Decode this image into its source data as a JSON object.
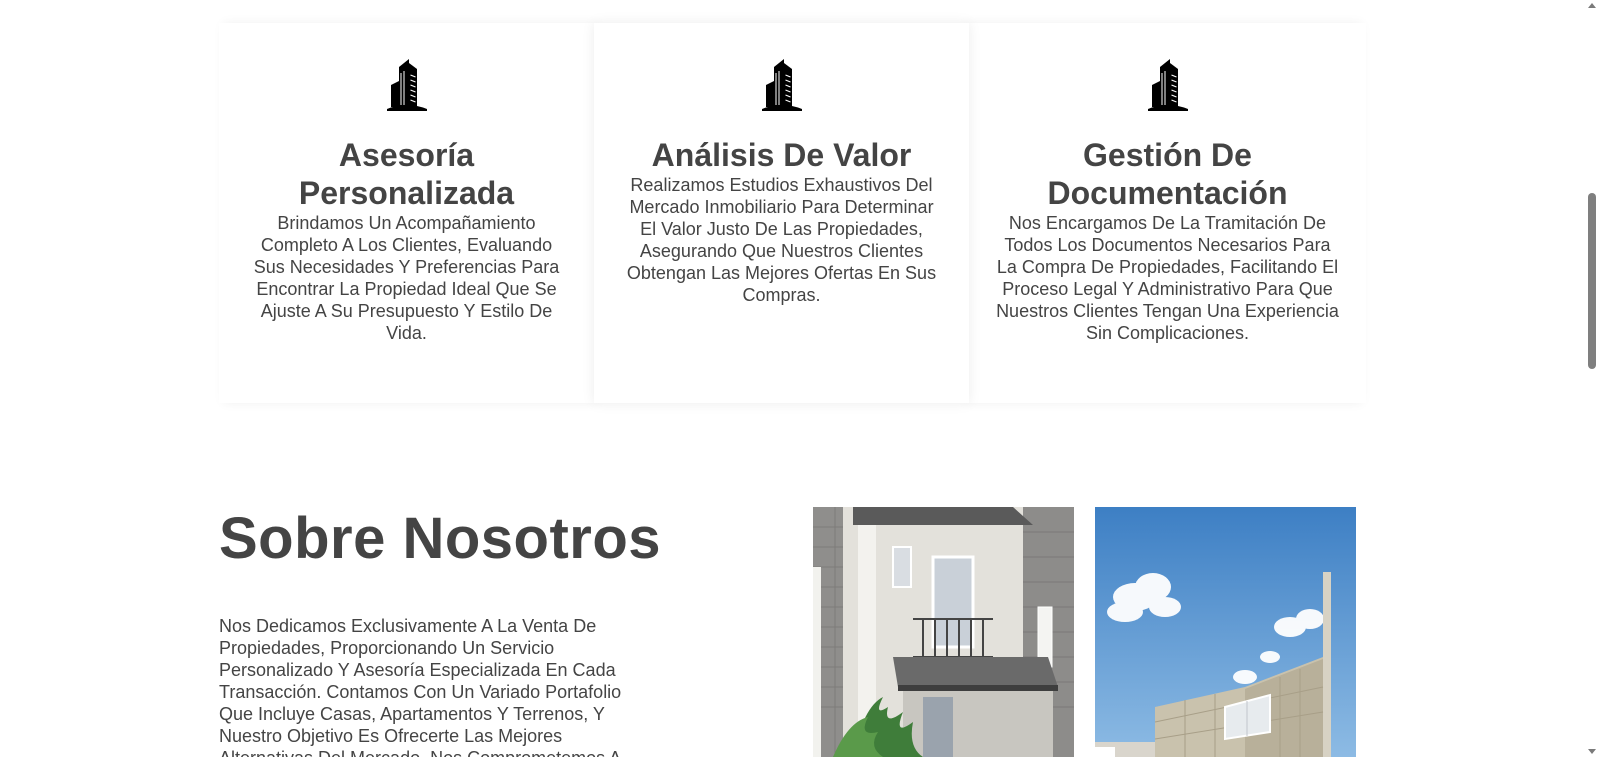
{
  "services": [
    {
      "icon": "building-icon",
      "title": "Asesoría Personalizada",
      "description": "Brindamos Un Acompañamiento Completo A Los Clientes, Evaluando Sus Necesidades Y Preferencias Para Encontrar La Propiedad Ideal Que Se Ajuste A Su Presupuesto Y Estilo De Vida."
    },
    {
      "icon": "building-icon",
      "title": "Análisis De Valor",
      "description": "Realizamos Estudios Exhaustivos Del Mercado Inmobiliario Para Determinar El Valor Justo De Las Propiedades, Asegurando Que Nuestros Clientes Obtengan Las Mejores Ofertas En Sus Compras."
    },
    {
      "icon": "building-icon",
      "title": "Gestión De Documentación",
      "description": "Nos Encargamos De La Tramitación De Todos Los Documentos Necesarios Para La Compra De Propiedades, Facilitando El Proceso Legal Y Administrativo Para Que Nuestros Clientes Tengan Una Experiencia Sin Complicaciones."
    }
  ],
  "about": {
    "title": "Sobre Nosotros",
    "text": "Nos Dedicamos Exclusivamente A La Venta De Propiedades, Proporcionando Un Servicio Personalizado Y Asesoría Especializada En Cada Transacción. Contamos Con Un Variado Portafolio Que Incluye Casas, Apartamentos Y Terrenos, Y Nuestro Objetivo Es Ofrecerte Las Mejores Alternativas Del Mercado. Nos Comprometemos A"
  },
  "photos": [
    "townhouse-photo",
    "modern-house-photo"
  ],
  "colors": {
    "text": "#444444",
    "background": "#ffffff",
    "card": "#ffffff"
  }
}
